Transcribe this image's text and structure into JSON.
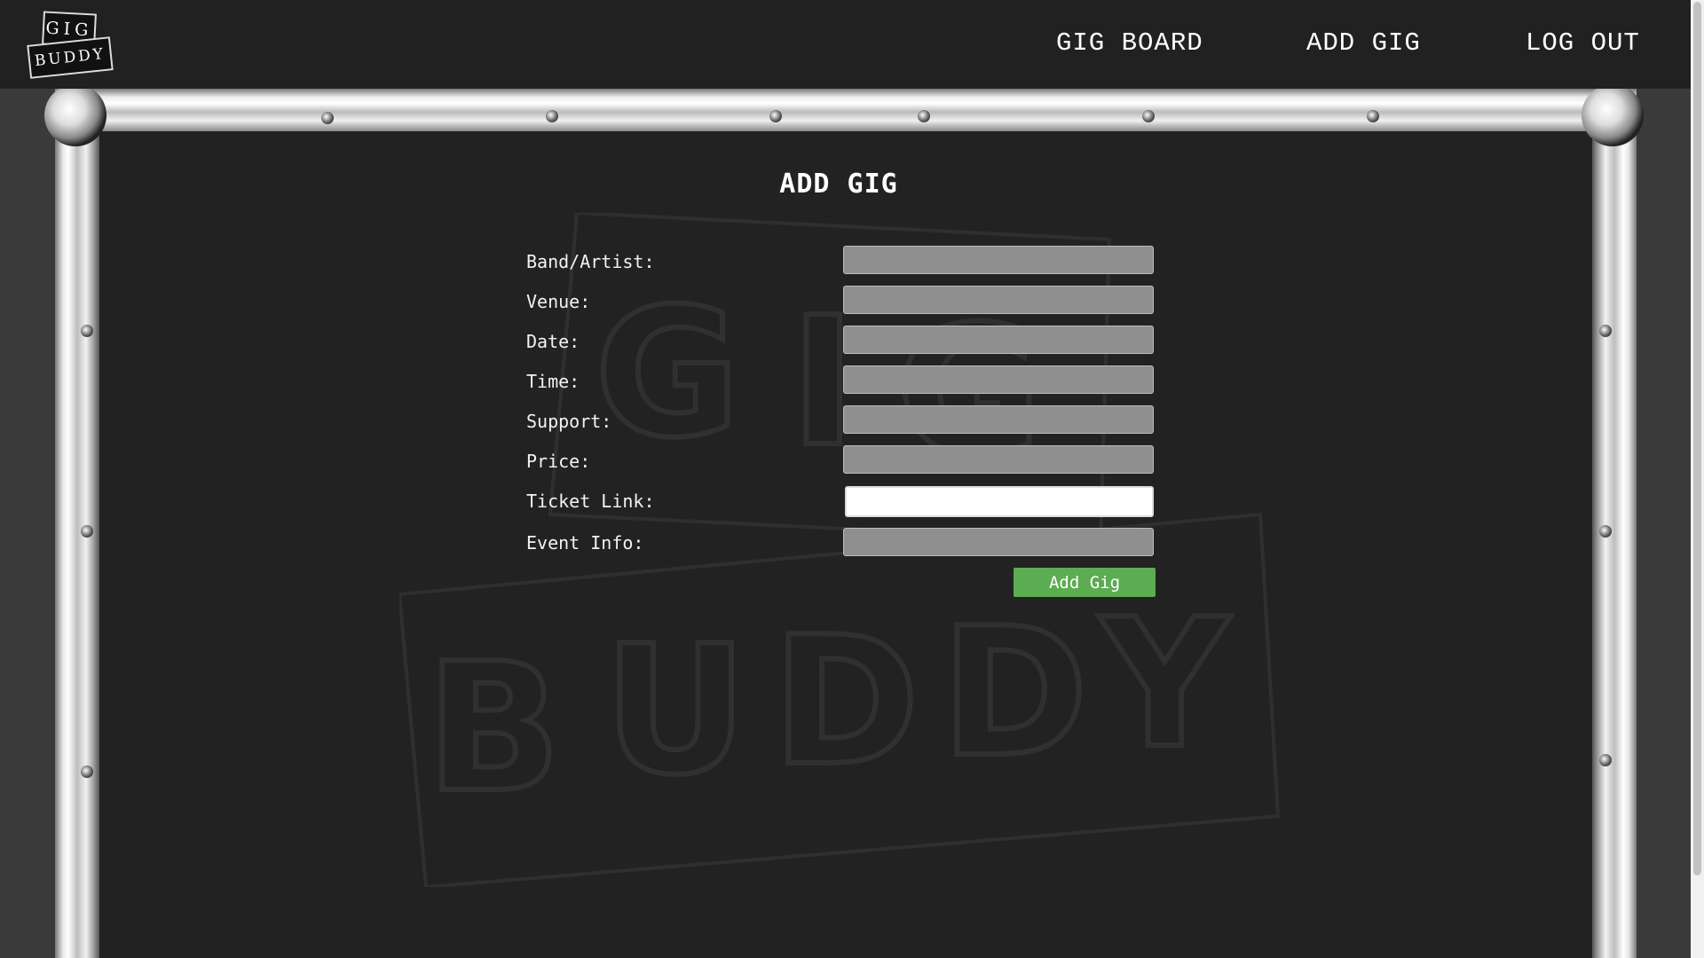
{
  "logo": {
    "line1": "GIG",
    "line2": "BUDDY"
  },
  "nav": {
    "gig_board": "GIG BOARD",
    "add_gig": "ADD GIG",
    "log_out": "LOG OUT"
  },
  "page": {
    "title": "ADD GIG"
  },
  "form": {
    "band_label": "Band/Artist:",
    "venue_label": "Venue:",
    "date_label": "Date:",
    "time_label": "Time:",
    "support_label": "Support:",
    "price_label": "Price:",
    "ticket_label": "Ticket Link:",
    "info_label": "Event Info:",
    "band_value": "",
    "venue_value": "",
    "date_value": "",
    "time_value": "",
    "support_value": "",
    "price_value": "",
    "ticket_value": "",
    "info_value": "",
    "submit_label": "Add Gig"
  },
  "colors": {
    "nav_bg": "#212121",
    "panel_bg": "#222222",
    "button": "#5cac52",
    "field": "#8f8f8f"
  }
}
